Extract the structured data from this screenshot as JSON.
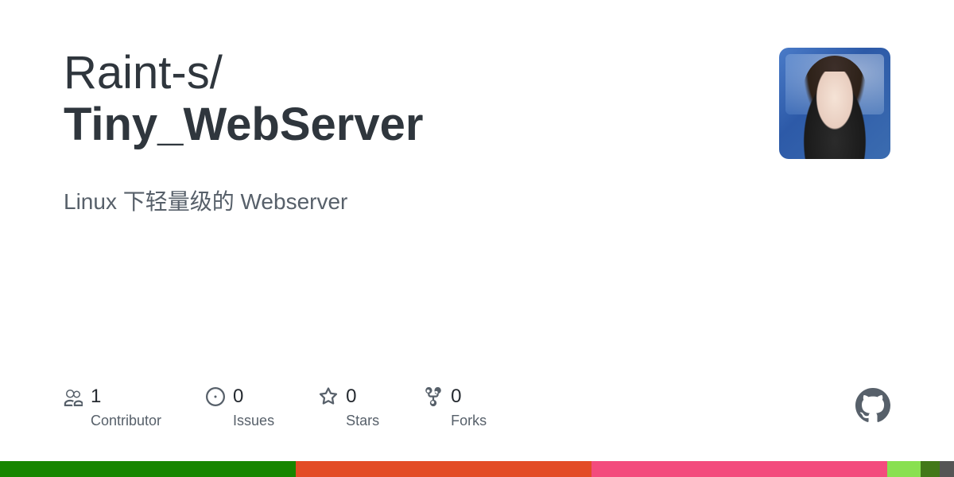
{
  "repo": {
    "owner": "Raint-s",
    "separator": "/",
    "name": "Tiny_WebServer",
    "description": "Linux 下轻量级的 Webserver"
  },
  "stats": {
    "contributors": {
      "value": "1",
      "label": "Contributor"
    },
    "issues": {
      "value": "0",
      "label": "Issues"
    },
    "stars": {
      "value": "0",
      "label": "Stars"
    },
    "forks": {
      "value": "0",
      "label": "Forks"
    }
  },
  "languages": [
    {
      "color": "#178600",
      "percent": 31
    },
    {
      "color": "#e34c26",
      "percent": 31
    },
    {
      "color": "#f34b7d",
      "percent": 31
    },
    {
      "color": "#89e051",
      "percent": 3.5
    },
    {
      "color": "#427819",
      "percent": 2
    },
    {
      "color": "#555555",
      "percent": 1.5
    }
  ]
}
